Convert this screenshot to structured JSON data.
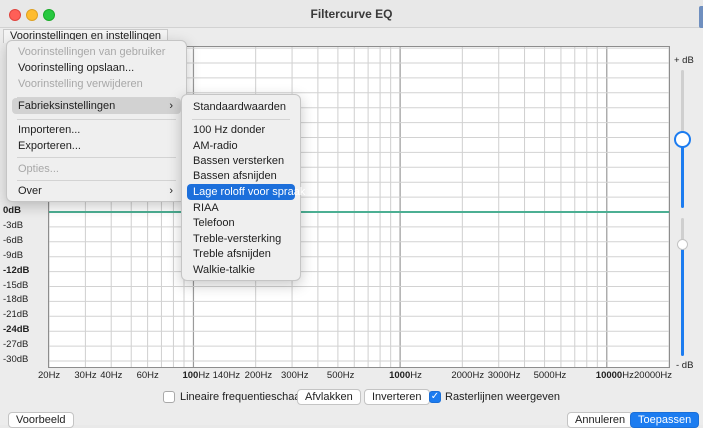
{
  "window": {
    "title": "Filtercurve EQ"
  },
  "menubar": {
    "label": "Voorinstellingen en instellingen"
  },
  "menu": {
    "items": [
      {
        "label": "Voorinstellingen van gebruiker",
        "disabled": true
      },
      {
        "label": "Voorinstelling opslaan...",
        "disabled": false
      },
      {
        "label": "Voorinstelling verwijderen",
        "disabled": true
      },
      {
        "label": "Fabrieksinstellingen",
        "submenu": true,
        "highlighted": true
      },
      {
        "label": "Importeren...",
        "disabled": false
      },
      {
        "label": "Exporteren...",
        "disabled": false
      },
      {
        "label": "Opties...",
        "disabled": true
      },
      {
        "label": "Over",
        "submenu": true
      }
    ],
    "submenu_glyph": "›"
  },
  "submenu": {
    "items": [
      {
        "label": "Standaardwaarden"
      },
      {
        "label": "100 Hz donder"
      },
      {
        "label": "AM-radio"
      },
      {
        "label": "Bassen versterken"
      },
      {
        "label": "Bassen afsnijden"
      },
      {
        "label": "Lage roloff voor spraak",
        "selected": true
      },
      {
        "label": "RIAA"
      },
      {
        "label": "Telefoon"
      },
      {
        "label": "Treble-versterking"
      },
      {
        "label": "Treble afsnijden"
      },
      {
        "label": "Walkie-talkie"
      }
    ]
  },
  "graph": {
    "y_labels": [
      "0dB",
      "-3dB",
      "-6dB",
      "-9dB",
      "-12dB",
      "-15dB",
      "-18dB",
      "-21dB",
      "-24dB",
      "-27dB",
      "-30dB"
    ],
    "x_labels": [
      {
        "text": "20Hz"
      },
      {
        "text": "30Hz"
      },
      {
        "text": "40Hz"
      },
      {
        "text": "60Hz"
      },
      {
        "text": "100",
        "suffix": "Hz",
        "bold": true
      },
      {
        "text": "140Hz"
      },
      {
        "text": "200Hz"
      },
      {
        "text": "300Hz"
      },
      {
        "text": "500Hz"
      },
      {
        "text": "1000",
        "suffix": "Hz",
        "bold": true
      },
      {
        "text": "2000Hz"
      },
      {
        "text": "3000Hz"
      },
      {
        "text": "5000Hz"
      },
      {
        "text": "10000",
        "suffix": "Hz",
        "bold": true
      },
      {
        "text": "20000Hz"
      }
    ],
    "curve_color": "#4caf93",
    "db_top": "+ dB",
    "db_bottom": "- dB"
  },
  "controls": {
    "linear_scale_label": "Lineaire frequentieschaal",
    "linear_scale_checked": false,
    "flatten_label": "Afvlakken",
    "invert_label": "Inverteren",
    "gridlines_label": "Rasterlijnen weergeven",
    "gridlines_checked": true
  },
  "footer": {
    "preview_label": "Voorbeeld",
    "cancel_label": "Annuleren",
    "apply_label": "Toepassen"
  },
  "colors": {
    "accent": "#1c7cf0",
    "curve": "#4caf93"
  }
}
